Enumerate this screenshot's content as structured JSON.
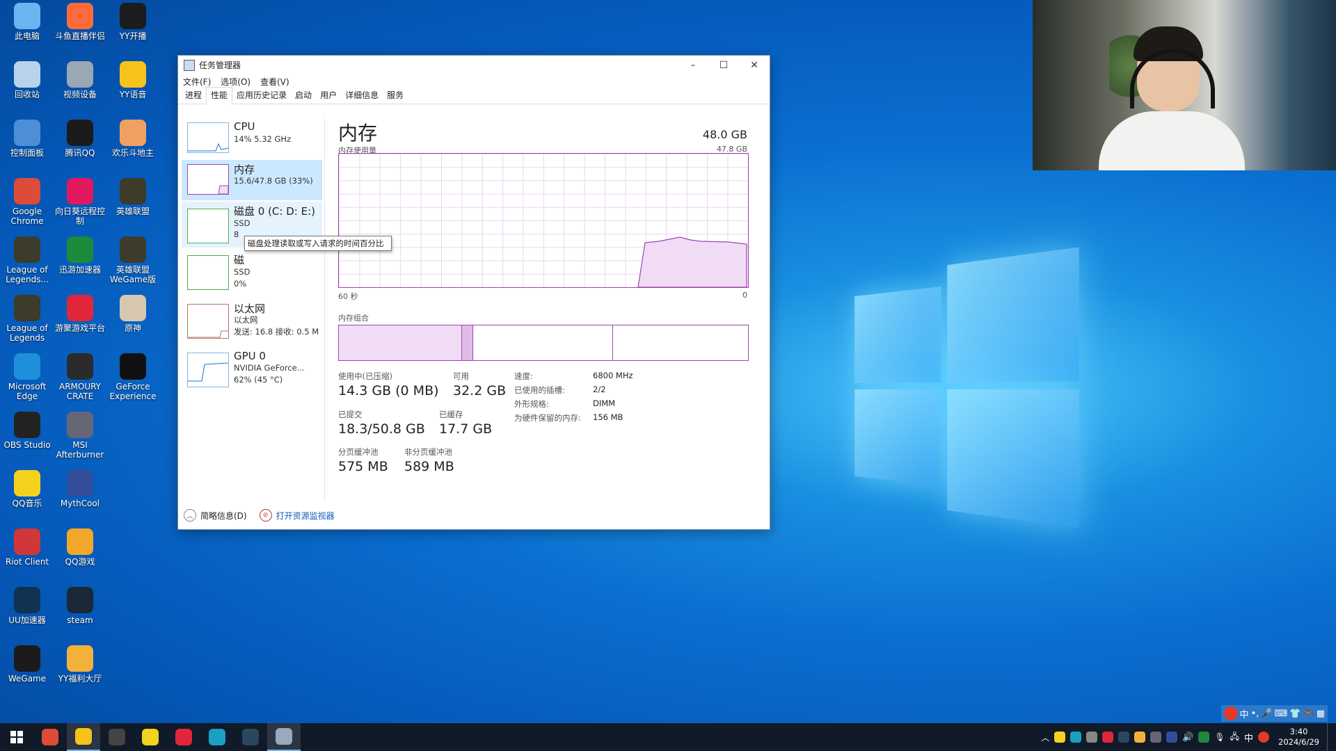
{
  "desktop": {
    "icons": [
      {
        "label": "此电脑",
        "color": "#6ab4f0"
      },
      {
        "label": "斗鱼直播伴侣",
        "color": "#ff6a3d"
      },
      {
        "label": "YY开播",
        "color": "#1c1c1c"
      },
      {
        "label": "回收站",
        "color": "#b8d2ea"
      },
      {
        "label": "视频设备",
        "color": "#9aa7b5"
      },
      {
        "label": "YY语音",
        "color": "#f7c31a"
      },
      {
        "label": "控制面板",
        "color": "#4c8fd6"
      },
      {
        "label": "腾讯QQ",
        "color": "#1b1b1b"
      },
      {
        "label": "欢乐斗地主",
        "color": "#f0a060"
      },
      {
        "label": "Google Chrome",
        "color": "#dd4b39"
      },
      {
        "label": "向日葵远程控制",
        "color": "#e0185e"
      },
      {
        "label": "英雄联盟",
        "color": "#3d3b2a"
      },
      {
        "label": "League of Legends...",
        "color": "#3d3b2a"
      },
      {
        "label": "迅游加速器",
        "color": "#1b8a3a"
      },
      {
        "label": "英雄联盟WeGame版",
        "color": "#3d3b2a"
      },
      {
        "label": "League of Legends",
        "color": "#3d3b2a"
      },
      {
        "label": "游聚游戏平台",
        "color": "#e0263a"
      },
      {
        "label": "原神",
        "color": "#d7c7b0"
      },
      {
        "label": "Microsoft Edge",
        "color": "#1f8fdb"
      },
      {
        "label": "ARMOURY CRATE",
        "color": "#2b2b2b"
      },
      {
        "label": "GeForce Experience",
        "color": "#111"
      },
      {
        "label": "OBS Studio",
        "color": "#222"
      },
      {
        "label": "MSI Afterburner",
        "color": "#667"
      },
      {
        "label": "QQ音乐",
        "color": "#f3d21e"
      },
      {
        "label": "MythCool",
        "color": "#344c9a"
      },
      {
        "label": "Riot Client",
        "color": "#d13639"
      },
      {
        "label": "QQ游戏",
        "color": "#f2a72a"
      },
      {
        "label": "UU加速器",
        "color": "#0f3350"
      },
      {
        "label": "steam",
        "color": "#1b2838"
      },
      {
        "label": "WeGame",
        "color": "#1b1b1b"
      },
      {
        "label": "YY福利大厅",
        "color": "#f4b13a"
      }
    ]
  },
  "window": {
    "title": "任务管理器",
    "minimize": "–",
    "maximize": "☐",
    "close": "✕",
    "menu": [
      "文件(F)",
      "选项(O)",
      "查看(V)"
    ],
    "tabs": [
      "进程",
      "性能",
      "应用历史记录",
      "启动",
      "用户",
      "详细信息",
      "服务"
    ],
    "active_tab": "性能"
  },
  "perf_list": [
    {
      "name": "CPU",
      "sub1": "14% 5.32 GHz",
      "sub2": ""
    },
    {
      "name": "内存",
      "sub1": "15.6/47.8 GB (33%)",
      "sub2": ""
    },
    {
      "name": "磁盘 0 (C: D: E:)",
      "sub1": "SSD",
      "sub2": "8"
    },
    {
      "name": "磁",
      "sub1": "SSD",
      "sub2": "0%"
    },
    {
      "name": "以太网",
      "sub1": "以太网",
      "sub2": "发送: 16.8 接收: 0.5 M"
    },
    {
      "name": "GPU 0",
      "sub1": "NVIDIA GeForce...",
      "sub2": "62% (45 °C)"
    }
  ],
  "memory": {
    "title": "内存",
    "total": "48.0 GB",
    "usage_label": "内存使用量",
    "usage_max": "47.8 GB",
    "axis_left": "60 秒",
    "axis_right": "0",
    "composition_label": "内存组合",
    "in_use_label": "使用中(已压缩)",
    "in_use_value": "14.3 GB (0 MB)",
    "available_label": "可用",
    "available_value": "32.2 GB",
    "committed_label": "已提交",
    "committed_value": "18.3/50.8 GB",
    "cached_label": "已缓存",
    "cached_value": "17.7 GB",
    "paged_label": "分页缓冲池",
    "paged_value": "575 MB",
    "nonpaged_label": "非分页缓冲池",
    "nonpaged_value": "589 MB",
    "speed_label": "速度:",
    "speed_value": "6800 MHz",
    "slots_label": "已使用的插槽:",
    "slots_value": "2/2",
    "form_label": "外形规格:",
    "form_value": "DIMM",
    "reserved_label": "为硬件保留的内存:",
    "reserved_value": "156 MB"
  },
  "footer": {
    "fewer": "简略信息(D)",
    "resmon": "打开资源监视器"
  },
  "tooltip": {
    "text": "磁盘处理读取或写入请求的时间百分比"
  },
  "taskbar": {
    "apps": [
      {
        "name": "chrome",
        "color": "#dd4b39",
        "active": false
      },
      {
        "name": "yy",
        "color": "#f7c31a",
        "active": true
      },
      {
        "name": "obs",
        "color": "#444",
        "active": false
      },
      {
        "name": "qqmusic",
        "color": "#f3d21e",
        "active": false
      },
      {
        "name": "game",
        "color": "#e0263a",
        "active": false
      },
      {
        "name": "uu",
        "color": "#1aa0c0",
        "active": false
      },
      {
        "name": "steam",
        "color": "#2a475e",
        "active": false
      },
      {
        "name": "taskmgr",
        "color": "#9aa9c0",
        "active": true
      }
    ],
    "time": "3:40",
    "date": "2024/6/29",
    "ime_lang": "中",
    "ime_items": [
      "中",
      "•,",
      "🎤",
      "⌨",
      "👕",
      "🎮",
      "▦"
    ]
  }
}
